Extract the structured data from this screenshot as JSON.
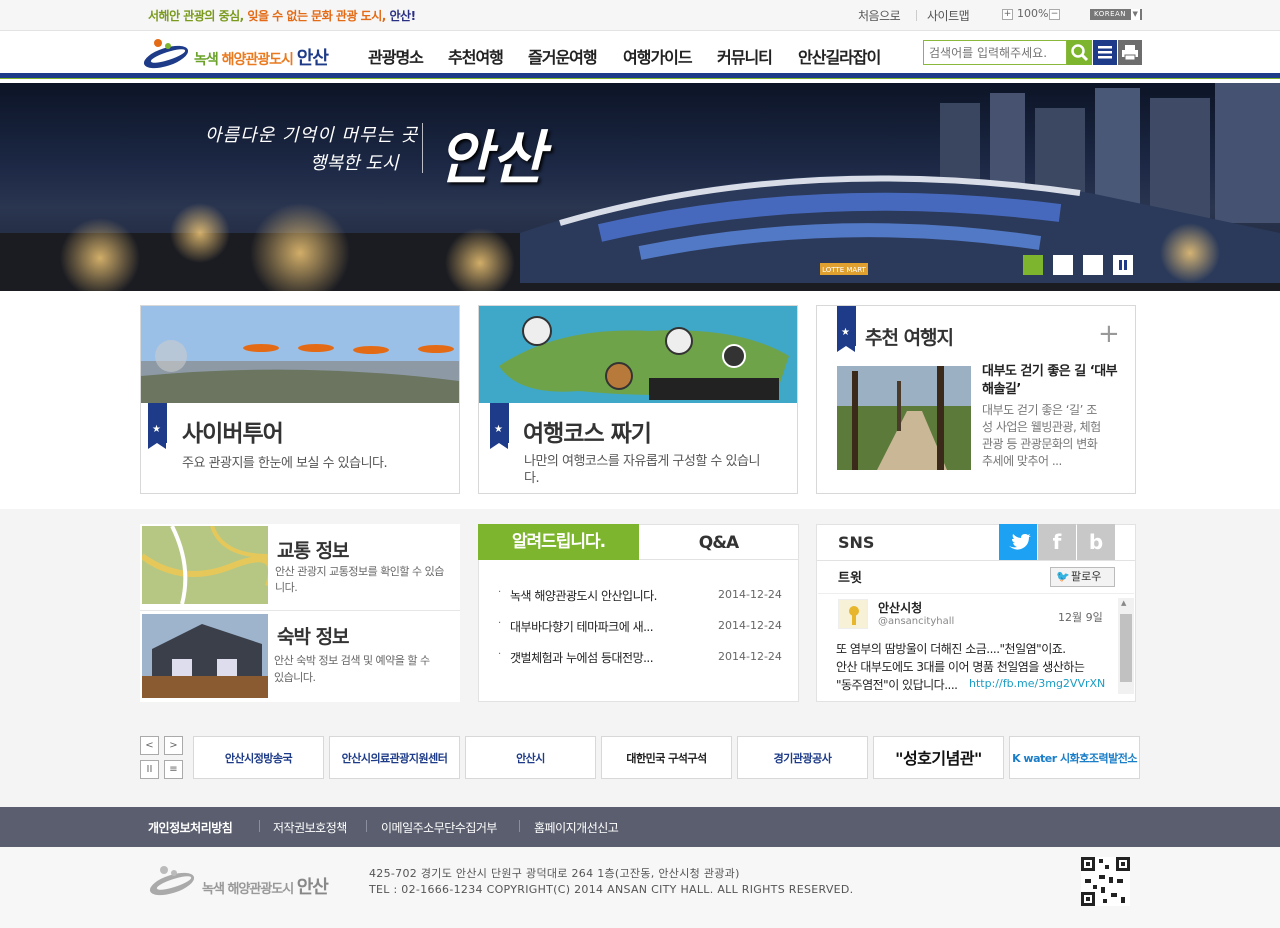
{
  "topbar": {
    "slogan_part1": "서해안 관광의 중심, ",
    "slogan_part2": "잊을 수 없는 문화 관광 도시, ",
    "slogan_part3": "안산!",
    "home_link": "처음으로",
    "sitemap_link": "사이트맵",
    "zoom_in": "+",
    "zoom_value": "100%",
    "zoom_out": "−",
    "language": "KOREAN"
  },
  "header": {
    "logo_part1": "녹색 ",
    "logo_part2": "해양관광도시 ",
    "logo_part3": "안산",
    "nav": [
      "관광명소",
      "추천여행",
      "즐거운여행",
      "여행가이드",
      "커뮤니티",
      "안산길라잡이"
    ],
    "search_placeholder": "검색어를 입력해주세요."
  },
  "banner": {
    "line1": "아름다운 기억이 머무는 곳",
    "line2": "행복한 도시",
    "big": "안산",
    "stadium_sign": "LOTTE MART"
  },
  "boxes": {
    "cyber_title": "사이버투어",
    "cyber_desc": "주요 관광지를 한눈에 보실 수 있습니다.",
    "course_title": "여행코스 짜기",
    "course_desc": "나만의 여행코스를 자유롭게 구성할 수 있습니다.",
    "rec_title": "추천 여행지",
    "rec_item_title": "대부도 걷기 좋은 길 ‘대부 해솔길’",
    "rec_item_desc": "대부도 걷기 좋은 ‘길’ 조성 사업은 웰빙관광, 체험관광 등 관광문화의 변화추세에 맞추어 ..."
  },
  "info": {
    "traffic_title": "교통 정보",
    "traffic_desc": "안산 관광지 교통정보를 확인할 수 있습니다.",
    "lodging_title": "숙박 정보",
    "lodging_desc": "안산 숙박 정보 검색 및 예약을 할 수 있습니다."
  },
  "notice": {
    "tab_notice": "알려드립니다.",
    "tab_qa": "Q&A",
    "items": [
      {
        "title": "녹색 해양관광도시 안산입니다.",
        "date": "2014-12-24"
      },
      {
        "title": "대부바다향기 테마파크에 새...",
        "date": "2014-12-24"
      },
      {
        "title": "갯벌체험과 누에섬 등대전망...",
        "date": "2014-12-24"
      }
    ]
  },
  "sns": {
    "title": "SNS",
    "twitter_label": "트윗",
    "follow": "팔로우",
    "account_name": "안산시청",
    "account_handle": "@ansancityhall",
    "date": "12월 9일",
    "tweet_line1": "또 염부의 땀방울이 더해진 소금....\"천일염\"이죠.",
    "tweet_line2": "안산 대부도에도 3대를 이어 명품 천일염을 생산하는",
    "tweet_line3": "\"동주염전\"이 있답니다....",
    "tweet_link": "http://fb.me/3mg2VVrXN"
  },
  "partners": [
    "안산시정방송국",
    "안산시의료관광지원센터",
    "안산시",
    "대한민국 구석구석",
    "경기관광공사",
    "\"성호기념관\"",
    "K water 시화호조력발전소"
  ],
  "footer": {
    "links": [
      "개인정보처리방침",
      "저작권보호정책",
      "이메일주소무단수집거부",
      "홈페이지개선신고"
    ],
    "logo_part1": "녹색 해양관광도시 ",
    "logo_part2": "안산",
    "address": "425-702  경기도 안산시 단원구 광덕대로 264 1층(고잔동, 안산시청 관광과)",
    "copyright": "TEL : 02-1666-1234    COPYRIGHT(C) 2014 ANSAN CITY HALL. ALL RIGHTS RESERVED."
  },
  "colors": {
    "navy": "#1d3b88",
    "green": "#7db52e",
    "orange": "#e46b16",
    "twitter": "#1da1f2"
  }
}
